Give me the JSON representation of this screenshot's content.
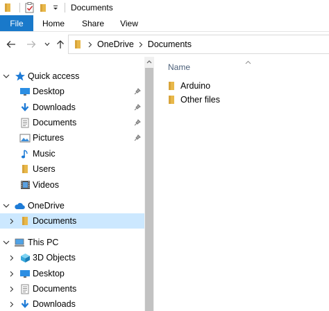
{
  "titlebar": {
    "title": "Documents"
  },
  "ribbon": {
    "tabs": [
      "File",
      "Home",
      "Share",
      "View"
    ]
  },
  "address": {
    "crumbs": [
      "OneDrive",
      "Documents"
    ]
  },
  "nav_pane": {
    "quick_access": {
      "label": "Quick access",
      "items": [
        {
          "label": "Desktop",
          "icon": "desktop-icon",
          "pinned": true
        },
        {
          "label": "Downloads",
          "icon": "downloads-icon",
          "pinned": true
        },
        {
          "label": "Documents",
          "icon": "documents-icon",
          "pinned": true
        },
        {
          "label": "Pictures",
          "icon": "pictures-icon",
          "pinned": true
        },
        {
          "label": "Music",
          "icon": "music-icon",
          "pinned": false
        },
        {
          "label": "Users",
          "icon": "folder-icon",
          "pinned": false
        },
        {
          "label": "Videos",
          "icon": "videos-icon",
          "pinned": false
        }
      ]
    },
    "onedrive": {
      "label": "OneDrive",
      "items": [
        {
          "label": "Documents",
          "icon": "folder-icon",
          "selected": true
        }
      ]
    },
    "this_pc": {
      "label": "This PC",
      "items": [
        {
          "label": "3D Objects",
          "icon": "3d-objects-icon"
        },
        {
          "label": "Desktop",
          "icon": "desktop-icon"
        },
        {
          "label": "Documents",
          "icon": "documents-icon"
        },
        {
          "label": "Downloads",
          "icon": "downloads-icon"
        }
      ]
    }
  },
  "content": {
    "column_header": "Name",
    "files": [
      {
        "name": "Arduino",
        "icon": "folder-icon"
      },
      {
        "name": "Other files",
        "icon": "folder-icon"
      }
    ]
  },
  "colors": {
    "file_tab": "#1979ca",
    "selection": "#cce8ff",
    "folder": "#e8b84a",
    "accent_blue": "#1e7bd6"
  }
}
